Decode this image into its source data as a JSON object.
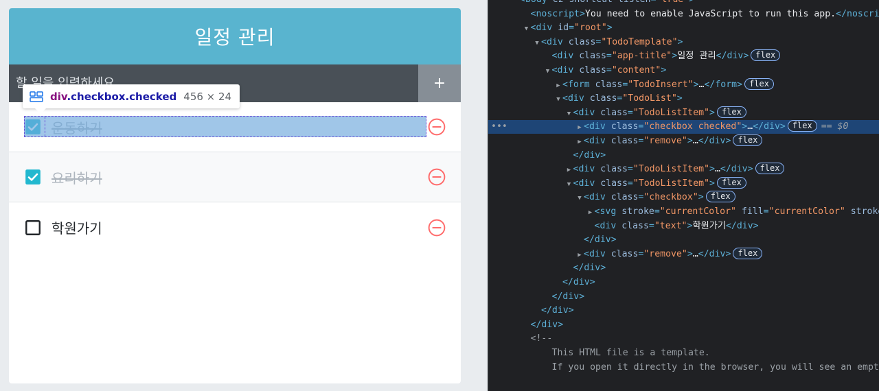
{
  "app": {
    "title": "일정 관리",
    "insert_placeholder": "할 일을 입력하세요",
    "insert_button": "+"
  },
  "todos": [
    {
      "text": "운동하기",
      "checked": true
    },
    {
      "text": "요리하기",
      "checked": true
    },
    {
      "text": "학원가기",
      "checked": false
    }
  ],
  "inspect_tooltip": {
    "tag": "div",
    "class": ".checkbox.checked",
    "size": "456 × 24"
  },
  "colors": {
    "title_bg": "#59b4cf",
    "insert_bg": "#495057",
    "checked_icon": "#22b8cf",
    "remove_icon": "#ff6b6b"
  },
  "devtools": {
    "lines": [
      {
        "indent": 0,
        "tri": "",
        "parts": [
          [
            "tag",
            "<body "
          ],
          [
            "attr",
            "cz-shortcut-listen"
          ],
          [
            "tag",
            "="
          ],
          [
            "val",
            "\"true\""
          ],
          [
            "tag",
            ">"
          ]
        ]
      },
      {
        "indent": 1,
        "tri": "",
        "parts": [
          [
            "tag",
            "<noscript>"
          ],
          [
            "text",
            "You need to enable JavaScript to run this app."
          ],
          [
            "tag",
            "</noscript>"
          ]
        ]
      },
      {
        "indent": 1,
        "tri": "down",
        "parts": [
          [
            "tag",
            "<div "
          ],
          [
            "attr",
            "id"
          ],
          [
            "tag",
            "="
          ],
          [
            "val",
            "\"root\""
          ],
          [
            "tag",
            ">"
          ]
        ]
      },
      {
        "indent": 2,
        "tri": "down",
        "parts": [
          [
            "tag",
            "<div "
          ],
          [
            "attr",
            "class"
          ],
          [
            "tag",
            "="
          ],
          [
            "val",
            "\"TodoTemplate\""
          ],
          [
            "tag",
            ">"
          ]
        ]
      },
      {
        "indent": 3,
        "tri": "",
        "parts": [
          [
            "tag",
            "<div "
          ],
          [
            "attr",
            "class"
          ],
          [
            "tag",
            "="
          ],
          [
            "val",
            "\"app-title\""
          ],
          [
            "tag",
            ">"
          ],
          [
            "text",
            "일정 관리"
          ],
          [
            "tag",
            "</div>"
          ]
        ],
        "badge": "flex"
      },
      {
        "indent": 3,
        "tri": "down",
        "parts": [
          [
            "tag",
            "<div "
          ],
          [
            "attr",
            "class"
          ],
          [
            "tag",
            "="
          ],
          [
            "val",
            "\"content\""
          ],
          [
            "tag",
            ">"
          ]
        ]
      },
      {
        "indent": 4,
        "tri": "right",
        "parts": [
          [
            "tag",
            "<form "
          ],
          [
            "attr",
            "class"
          ],
          [
            "tag",
            "="
          ],
          [
            "val",
            "\"TodoInsert\""
          ],
          [
            "tag",
            ">"
          ],
          [
            "text",
            "…"
          ],
          [
            "tag",
            "</form>"
          ]
        ],
        "badge": "flex"
      },
      {
        "indent": 4,
        "tri": "down",
        "parts": [
          [
            "tag",
            "<div "
          ],
          [
            "attr",
            "class"
          ],
          [
            "tag",
            "="
          ],
          [
            "val",
            "\"TodoList\""
          ],
          [
            "tag",
            ">"
          ]
        ]
      },
      {
        "indent": 5,
        "tri": "down",
        "parts": [
          [
            "tag",
            "<div "
          ],
          [
            "attr",
            "class"
          ],
          [
            "tag",
            "="
          ],
          [
            "val",
            "\"TodoListItem\""
          ],
          [
            "tag",
            ">"
          ]
        ],
        "badge": "flex"
      },
      {
        "indent": 6,
        "tri": "right",
        "parts": [
          [
            "tag",
            "<div "
          ],
          [
            "attr",
            "class"
          ],
          [
            "tag",
            "="
          ],
          [
            "val",
            "\"checkbox checked\""
          ],
          [
            "tag",
            ">"
          ],
          [
            "text",
            "…"
          ],
          [
            "tag",
            "</div>"
          ]
        ],
        "badge": "flex",
        "selected": true,
        "eq": "== $0"
      },
      {
        "indent": 6,
        "tri": "right",
        "parts": [
          [
            "tag",
            "<div "
          ],
          [
            "attr",
            "class"
          ],
          [
            "tag",
            "="
          ],
          [
            "val",
            "\"remove\""
          ],
          [
            "tag",
            ">"
          ],
          [
            "text",
            "…"
          ],
          [
            "tag",
            "</div>"
          ]
        ],
        "badge": "flex"
      },
      {
        "indent": 5,
        "tri": "",
        "parts": [
          [
            "tag",
            "</div>"
          ]
        ]
      },
      {
        "indent": 5,
        "tri": "right",
        "parts": [
          [
            "tag",
            "<div "
          ],
          [
            "attr",
            "class"
          ],
          [
            "tag",
            "="
          ],
          [
            "val",
            "\"TodoListItem\""
          ],
          [
            "tag",
            ">"
          ],
          [
            "text",
            "…"
          ],
          [
            "tag",
            "</div>"
          ]
        ],
        "badge": "flex"
      },
      {
        "indent": 5,
        "tri": "down",
        "parts": [
          [
            "tag",
            "<div "
          ],
          [
            "attr",
            "class"
          ],
          [
            "tag",
            "="
          ],
          [
            "val",
            "\"TodoListItem\""
          ],
          [
            "tag",
            ">"
          ]
        ],
        "badge": "flex"
      },
      {
        "indent": 6,
        "tri": "down",
        "parts": [
          [
            "tag",
            "<div "
          ],
          [
            "attr",
            "class"
          ],
          [
            "tag",
            "="
          ],
          [
            "val",
            "\"checkbox\""
          ],
          [
            "tag",
            ">"
          ]
        ],
        "badge": "flex"
      },
      {
        "indent": 7,
        "tri": "right",
        "parts": [
          [
            "tag",
            "<svg "
          ],
          [
            "attr",
            "stroke"
          ],
          [
            "tag",
            "="
          ],
          [
            "val",
            "\"currentColor\""
          ],
          [
            "text",
            " "
          ],
          [
            "attr",
            "fill"
          ],
          [
            "tag",
            "="
          ],
          [
            "val",
            "\"currentColor\""
          ],
          [
            "text",
            " "
          ],
          [
            "attr",
            "stroke-width"
          ]
        ]
      },
      {
        "indent": 7,
        "tri": "",
        "parts": [
          [
            "tag",
            "<div "
          ],
          [
            "attr",
            "class"
          ],
          [
            "tag",
            "="
          ],
          [
            "val",
            "\"text\""
          ],
          [
            "tag",
            ">"
          ],
          [
            "text",
            "학원가기"
          ],
          [
            "tag",
            "</div>"
          ]
        ]
      },
      {
        "indent": 6,
        "tri": "",
        "parts": [
          [
            "tag",
            "</div>"
          ]
        ]
      },
      {
        "indent": 6,
        "tri": "right",
        "parts": [
          [
            "tag",
            "<div "
          ],
          [
            "attr",
            "class"
          ],
          [
            "tag",
            "="
          ],
          [
            "val",
            "\"remove\""
          ],
          [
            "tag",
            ">"
          ],
          [
            "text",
            "…"
          ],
          [
            "tag",
            "</div>"
          ]
        ],
        "badge": "flex"
      },
      {
        "indent": 5,
        "tri": "",
        "parts": [
          [
            "tag",
            "</div>"
          ]
        ]
      },
      {
        "indent": 4,
        "tri": "",
        "parts": [
          [
            "tag",
            "</div>"
          ]
        ]
      },
      {
        "indent": 3,
        "tri": "",
        "parts": [
          [
            "tag",
            "</div>"
          ]
        ]
      },
      {
        "indent": 2,
        "tri": "",
        "parts": [
          [
            "tag",
            "</div>"
          ]
        ]
      },
      {
        "indent": 1,
        "tri": "",
        "parts": [
          [
            "tag",
            "</div>"
          ]
        ]
      },
      {
        "indent": 1,
        "tri": "",
        "parts": [
          [
            "com",
            "<!--"
          ]
        ]
      },
      {
        "indent": 3,
        "tri": "",
        "parts": [
          [
            "com",
            "This HTML file is a template."
          ]
        ]
      },
      {
        "indent": 3,
        "tri": "",
        "parts": [
          [
            "com",
            "If you open it directly in the browser, you will see an empty page."
          ]
        ]
      }
    ]
  }
}
